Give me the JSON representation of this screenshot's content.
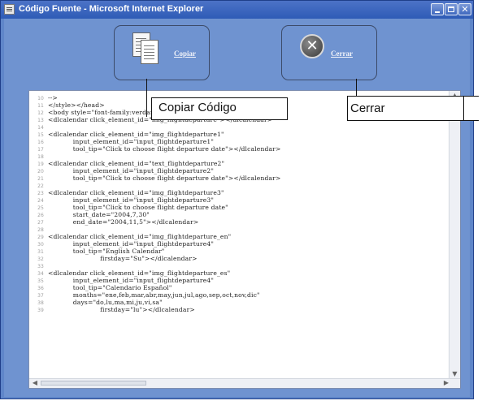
{
  "window": {
    "title": "Código Fuente - Microsoft Internet Explorer",
    "buttons": {
      "minimize": "",
      "maximize": "",
      "close": "✕"
    }
  },
  "toolbar": {
    "copy_label": "Copiar",
    "close_label": "Cerrar",
    "copy_icon": "copy-document-icon",
    "close_icon": "close-x-icon",
    "close_glyph": "✕"
  },
  "callouts": {
    "copy": "Copiar Código",
    "close": "Cerrar"
  },
  "code": {
    "lines": [
      {
        "n": "10",
        "t": "-->"
      },
      {
        "n": "11",
        "t": "</style></head>"
      },
      {
        "n": "12",
        "t": "<body style=\"font-family:verdana;font-size:12px;\">"
      },
      {
        "n": "13",
        "t": "<dlcalendar click_element_id=\"img_flightdeparture\"></dlcalendar>"
      },
      {
        "n": "14",
        "t": ""
      },
      {
        "n": "15",
        "t": "<dlcalendar click_element_id=\"img_flightdeparture1\""
      },
      {
        "n": "16",
        "t": "            input_element_id=\"input_flightdeparture1\""
      },
      {
        "n": "17",
        "t": "            tool_tip=\"Click to choose flight departure date\"></dlcalendar>"
      },
      {
        "n": "18",
        "t": ""
      },
      {
        "n": "19",
        "t": "<dlcalendar click_element_id=\"text_flightdeparture2\""
      },
      {
        "n": "20",
        "t": "            input_element_id=\"input_flightdeparture2\""
      },
      {
        "n": "21",
        "t": "            tool_tip=\"Click to choose flight departure date\"></dlcalendar>"
      },
      {
        "n": "22",
        "t": ""
      },
      {
        "n": "23",
        "t": "<dlcalendar click_element_id=\"img_flightdeparture3\""
      },
      {
        "n": "24",
        "t": "            input_element_id=\"input_flightdeparture3\""
      },
      {
        "n": "25",
        "t": "            tool_tip=\"Click to choose flight departure date\""
      },
      {
        "n": "26",
        "t": "            start_date=\"2004,7,30\""
      },
      {
        "n": "27",
        "t": "            end_date=\"2004,11,5\"></dlcalendar>"
      },
      {
        "n": "28",
        "t": ""
      },
      {
        "n": "29",
        "t": "<dlcalendar click_element_id=\"img_flightdeparture_en\""
      },
      {
        "n": "30",
        "t": "            input_element_id=\"input_flightdeparture4\""
      },
      {
        "n": "31",
        "t": "            tool_tip=\"English Calendar\""
      },
      {
        "n": "32",
        "t": "                         firstday=\"Su\"></dlcalendar>"
      },
      {
        "n": "33",
        "t": ""
      },
      {
        "n": "34",
        "t": "<dlcalendar click_element_id=\"img_flightdeparture_es\""
      },
      {
        "n": "35",
        "t": "            input_element_id=\"input_flightdeparture4\""
      },
      {
        "n": "36",
        "t": "            tool_tip=\"Calendario Español\""
      },
      {
        "n": "37",
        "t": "            months=\"ene,feb,mar,abr,may,jun,jul,ago,sep,oct,nov,dic\""
      },
      {
        "n": "38",
        "t": "            days=\"do,lu,ma,mi,ju,vi,sa\""
      },
      {
        "n": "39",
        "t": "                         firstday=\"lu\"></dlcalendar>"
      }
    ]
  },
  "colors": {
    "window_bg": "#6f93d0",
    "titlebar": "#2e5bb6",
    "code_bg": "#ffffff"
  }
}
